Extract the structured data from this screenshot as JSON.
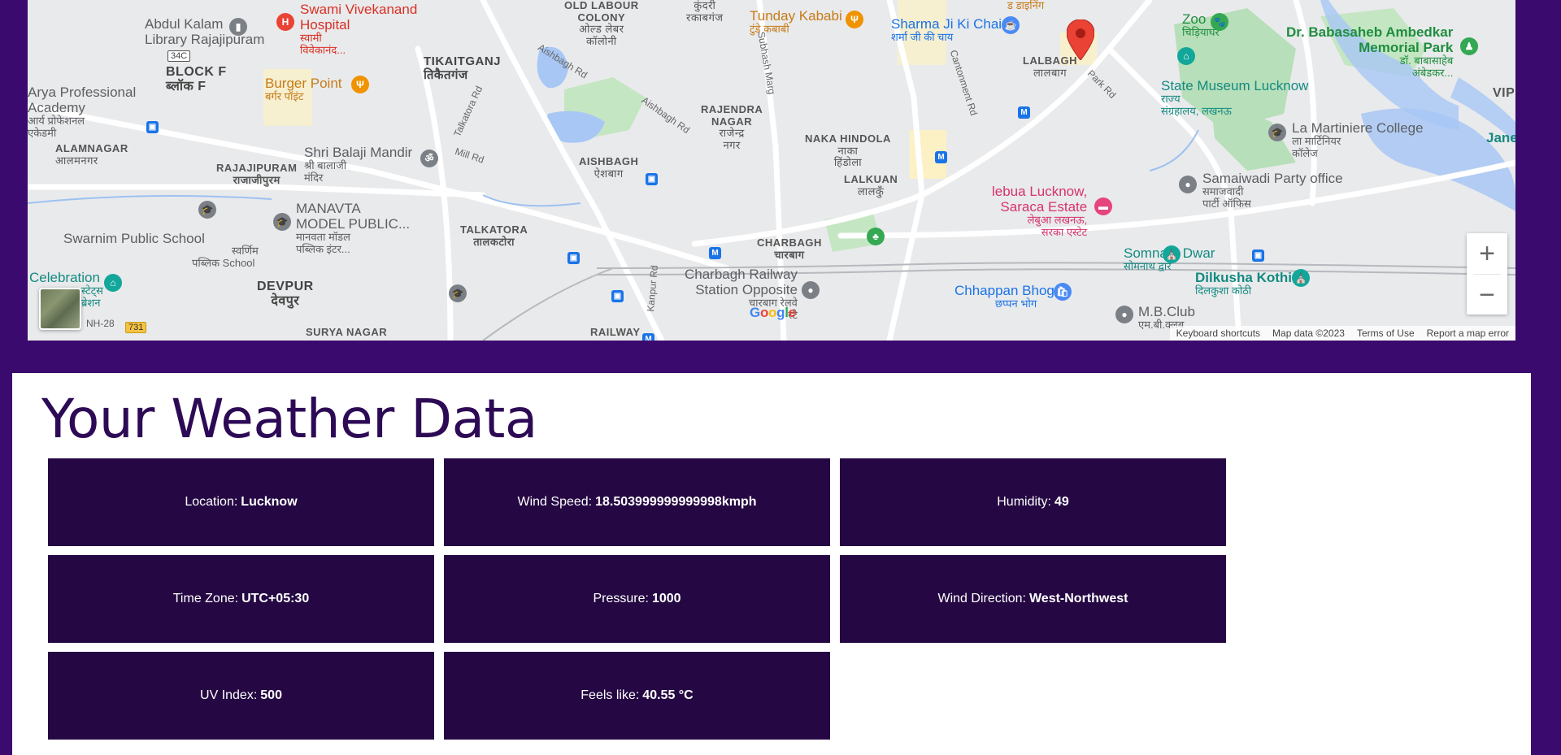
{
  "map": {
    "labels": {
      "abdul_kalam": "Abdul Kalam",
      "abdul_kalam_sub": "Library Rajajipuram",
      "swami_vivekanand": "Swami Vivekanand",
      "hospital": "Hospital",
      "swami_hi": "स्वामी",
      "vivekanand_hi": "विवेकानंद...",
      "old_labour": "OLD LABOUR",
      "colony": "COLONY",
      "old_labour_hi": "ओल्ड लेबर",
      "colony_hi": "कॉलोनी",
      "kundari": "कुंदरी",
      "rakabganj_hi": "रकाबगंज",
      "tunday": "Tunday Kababi",
      "tunday_hi": "टुंडे कबाबी",
      "sharma": "Sharma Ji Ki Chai",
      "sharma_hi": "शर्मा जी की चाय",
      "dining": "ड डाइनिंग",
      "zoo": "Zoo",
      "zoo_hi": "चिड़ियाघर",
      "ambedkar": "Dr. Babasaheb Ambedkar",
      "memorial": "Memorial Park",
      "ambedkar_hi1": "डॉ. बाबासाहेब",
      "ambedkar_hi2": "अंबेडकर...",
      "vip": "VIP",
      "badge_34c": "34C",
      "block_f": "BLOCK F",
      "block_f_hi": "ब्लॉक F",
      "tikaitganj": "TIKAITGANJ",
      "tikaitganj_hi": "तिकैतगंज",
      "arya": "Arya Professional",
      "academy": "Academy",
      "arya_hi1": "आर्य प्रोफेशनल",
      "arya_hi2": "एकेडमी",
      "burger": "Burger Point",
      "burger_hi": "बर्गर पॉइंट",
      "lalbagh": "LALBAGH",
      "lalbagh_hi": "लालबाग",
      "state_museum": "State Museum Lucknow",
      "state_museum_hi1": "राज्य",
      "state_museum_hi2": "संग्रहालय, लखनऊ",
      "rajendra": "RAJENDRA",
      "nagar": "NAGAR",
      "rajendra_hi1": "राजेन्द्र",
      "rajendra_hi2": "नगर",
      "naka": "NAKA HINDOLA",
      "naka_hi1": "नाका",
      "naka_hi2": "हिंडोला",
      "martiniere": "La Martiniere College",
      "martiniere_hi1": "ला मार्टिनियर",
      "martiniere_hi2": "कॉलेज",
      "jane": "Jane",
      "alamnagar": "ALAMNAGAR",
      "alamnagar_hi": "आलमनगर",
      "balaji": "Shri Balaji Mandir",
      "balaji_hi1": "श्री बालाजी",
      "balaji_hi2": "मंदिर",
      "aishbagh": "AISHBAGH",
      "aishbagh_hi": "ऐशबाग",
      "rajajipuram": "RAJAJIPURAM",
      "rajajipuram_hi": "राजाजीपुरम",
      "lalkuan": "LALKUAN",
      "lalkuan_hi": "लालकुँ",
      "samajwadi": "Samaiwadi Party office",
      "samajwadi_hi1": "समाजवादी",
      "samajwadi_hi2": "पार्टी ऑफिस",
      "lebua": "lebua Lucknow,",
      "saraca": "Saraca Estate",
      "lebua_hi1": "लेबुआ लखनऊ,",
      "lebua_hi2": "सरका एस्टेट",
      "manavta": "MANAVTA",
      "model": "MODEL PUBLIC...",
      "manavta_hi1": "मानवता मॉडल",
      "manavta_hi2": "पब्लिक इंटर...",
      "swarnim": "Swarnim Public School",
      "swarnim_hi1": "स्वर्णिम",
      "swarnim_hi2": "पब्लिक School",
      "talkatora": "TALKATORA",
      "talkatora_hi": "तालकटोरा",
      "charbagh": "CHARBAGH",
      "charbagh_hi": "चारबाग",
      "charbagh_rs": "Charbagh Railway",
      "station_opp": "Station Opposite",
      "charbagh_rs_hi1": "चारबाग रेलवे",
      "charbagh_rs_hi2": "स्टे",
      "somnath": "Somnath Dwar",
      "somnath_hi": "सोमनाथ द्वार",
      "dilkusha": "Dilkusha Kothi",
      "dilkusha_hi": "दिलकुशा कोठी",
      "celebration": "Celebration",
      "celebration_hi1": "स्टेट्स",
      "celebration_hi2": "ब्रेशन",
      "devpur": "DEVPUR",
      "devpur_hi": "देवपुर",
      "chhappan": "Chhappan Bhog",
      "chhappan_hi": "छप्पन भोग",
      "mb_club": "M.B.Club",
      "mb_club_hi": "एम.बी.क्लब",
      "surya": "SURYA NAGAR",
      "railway": "RAILWAY",
      "nh28": "NH-28",
      "badge_731": "731",
      "road_aishbagh1": "Aishbagh Rd",
      "road_aishbagh2": "Aishbagh Rd",
      "road_talkatora": "Talkatora Rd",
      "road_mill": "Mill Rd",
      "road_subhash": "Subhash Marg",
      "road_cantonment": "Cantonment Rd",
      "road_park": "Park Rd",
      "road_kanpur": "Kanpur Rd"
    },
    "zoom_in": "+",
    "zoom_out": "−",
    "google_logo": "Google",
    "attribution": {
      "keyboard": "Keyboard shortcuts",
      "map_data": "Map data ©2023",
      "terms": "Terms of Use",
      "report": "Report a map error"
    }
  },
  "weather": {
    "title": "Your Weather Data",
    "cards": [
      {
        "label": "Location:",
        "value": "Lucknow"
      },
      {
        "label": "Wind Speed:",
        "value": "18.503999999999998kmph"
      },
      {
        "label": "Humidity:",
        "value": "49"
      },
      {
        "label": "Time Zone:",
        "value": "UTC+05:30"
      },
      {
        "label": "Pressure:",
        "value": "1000"
      },
      {
        "label": "Wind Direction:",
        "value": "West-Northwest"
      },
      {
        "label": "UV Index:",
        "value": "500"
      },
      {
        "label": "Feels like:",
        "value": "40.55 °C"
      }
    ]
  },
  "colors": {
    "page_bg": "#3a0a6e",
    "card_bg": "#250843",
    "title": "#2d0a55",
    "map_marker": "#ea4335"
  }
}
